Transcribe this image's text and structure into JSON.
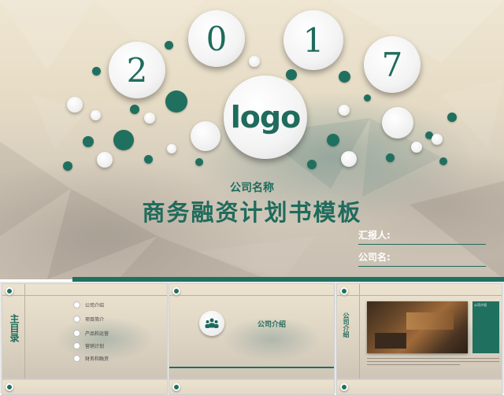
{
  "main_slide": {
    "year_digits": [
      "2",
      "0",
      "1",
      "7"
    ],
    "logo": "logo",
    "company_name": "公司名称",
    "title": "商务融资计划书模板",
    "reporter_label": "汇报人:",
    "company_label": "公司名:"
  },
  "thumbnails": [
    {
      "vertical_title": "主目录",
      "menu": [
        {
          "label": "公司介绍",
          "icon": "triangle-icon"
        },
        {
          "label": "项目简介",
          "icon": "document-icon"
        },
        {
          "label": "产品和运营",
          "icon": "gear-icon"
        },
        {
          "label": "营销计划",
          "icon": "cross-icon"
        },
        {
          "label": "财务和融资",
          "icon": "list-icon"
        }
      ]
    },
    {
      "section_title": "公司介绍",
      "icon": "team-icon"
    },
    {
      "vertical_title": "公司介绍",
      "side_heading": "公司介绍",
      "photo": "office-reception-photo"
    }
  ],
  "colors": {
    "accent": "#1f6b5c",
    "dot_green": "#20705f",
    "background": "#e6dcc6"
  }
}
